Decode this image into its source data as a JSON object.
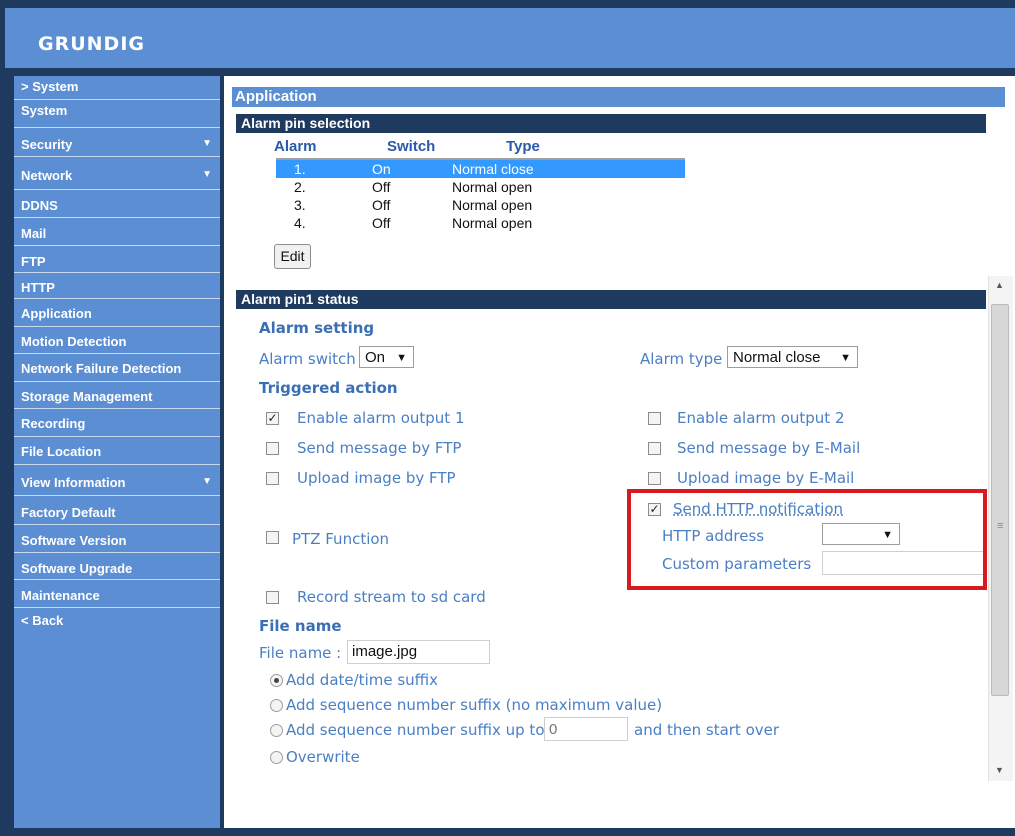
{
  "brand": {
    "logo": "GRUNDIG"
  },
  "sidebar": {
    "items": [
      {
        "label": "> System",
        "arrow": ""
      },
      {
        "label": "System",
        "arrow": ""
      },
      {
        "label": "Security",
        "arrow": "▼"
      },
      {
        "label": "Network",
        "arrow": "▼"
      },
      {
        "label": "DDNS",
        "arrow": ""
      },
      {
        "label": "Mail",
        "arrow": ""
      },
      {
        "label": "FTP",
        "arrow": ""
      },
      {
        "label": "HTTP",
        "arrow": ""
      },
      {
        "label": "Application",
        "arrow": ""
      },
      {
        "label": "Motion Detection",
        "arrow": ""
      },
      {
        "label": "Network Failure Detection",
        "arrow": ""
      },
      {
        "label": "Storage Management",
        "arrow": ""
      },
      {
        "label": "Recording",
        "arrow": ""
      },
      {
        "label": "File Location",
        "arrow": ""
      },
      {
        "label": "View Information",
        "arrow": "▼"
      },
      {
        "label": "Factory Default",
        "arrow": ""
      },
      {
        "label": "Software Version",
        "arrow": ""
      },
      {
        "label": "Software Upgrade",
        "arrow": ""
      },
      {
        "label": "Maintenance",
        "arrow": ""
      },
      {
        "label": "< Back",
        "arrow": ""
      }
    ]
  },
  "page": {
    "title": "Application"
  },
  "alarm_pin_selection": {
    "title": "Alarm pin selection",
    "columns": [
      "Alarm",
      "Switch",
      "Type"
    ],
    "rows": [
      {
        "alarm": "1.",
        "switch": "On",
        "type": "Normal close",
        "selected": true
      },
      {
        "alarm": "2.",
        "switch": "Off",
        "type": "Normal open",
        "selected": false
      },
      {
        "alarm": "3.",
        "switch": "Off",
        "type": "Normal open",
        "selected": false
      },
      {
        "alarm": "4.",
        "switch": "Off",
        "type": "Normal open",
        "selected": false
      }
    ],
    "edit_label": "Edit"
  },
  "alarm_status": {
    "title": "Alarm pin1 status",
    "setting_header": "Alarm setting",
    "alarm_switch_label": "Alarm switch",
    "alarm_switch_value": "On",
    "alarm_type_label": "Alarm type",
    "alarm_type_value": "Normal close",
    "triggered_header": "Triggered action",
    "enable_output_1": "Enable alarm output 1",
    "enable_output_2": "Enable alarm output 2",
    "send_ftp": "Send message by FTP",
    "send_email": "Send message by E-Mail",
    "upload_ftp": "Upload image by FTP",
    "upload_email": "Upload image by E-Mail",
    "send_http": "Send HTTP notification",
    "http_address_label": "HTTP address",
    "http_address_value": "",
    "custom_params_label": "Custom parameters",
    "custom_params_value": "",
    "ptz_function": "PTZ Function",
    "record_sd": "Record stream to sd card"
  },
  "file_name": {
    "header": "File name",
    "label": "File name :",
    "value": "image.jpg",
    "opt_datetime": "Add date/time suffix",
    "opt_seq_nomax": "Add sequence number suffix (no maximum value)",
    "opt_seq_upto": "Add sequence number suffix up to",
    "seq_upto_placeholder": "0",
    "opt_seq_upto_tail": "and then start over",
    "opt_overwrite": "Overwrite"
  },
  "colors": {
    "header_blue": "#5b8ed3",
    "dark_navy": "#1f3a5f",
    "highlight_red": "#d71920",
    "selection_blue": "#3399ff"
  }
}
